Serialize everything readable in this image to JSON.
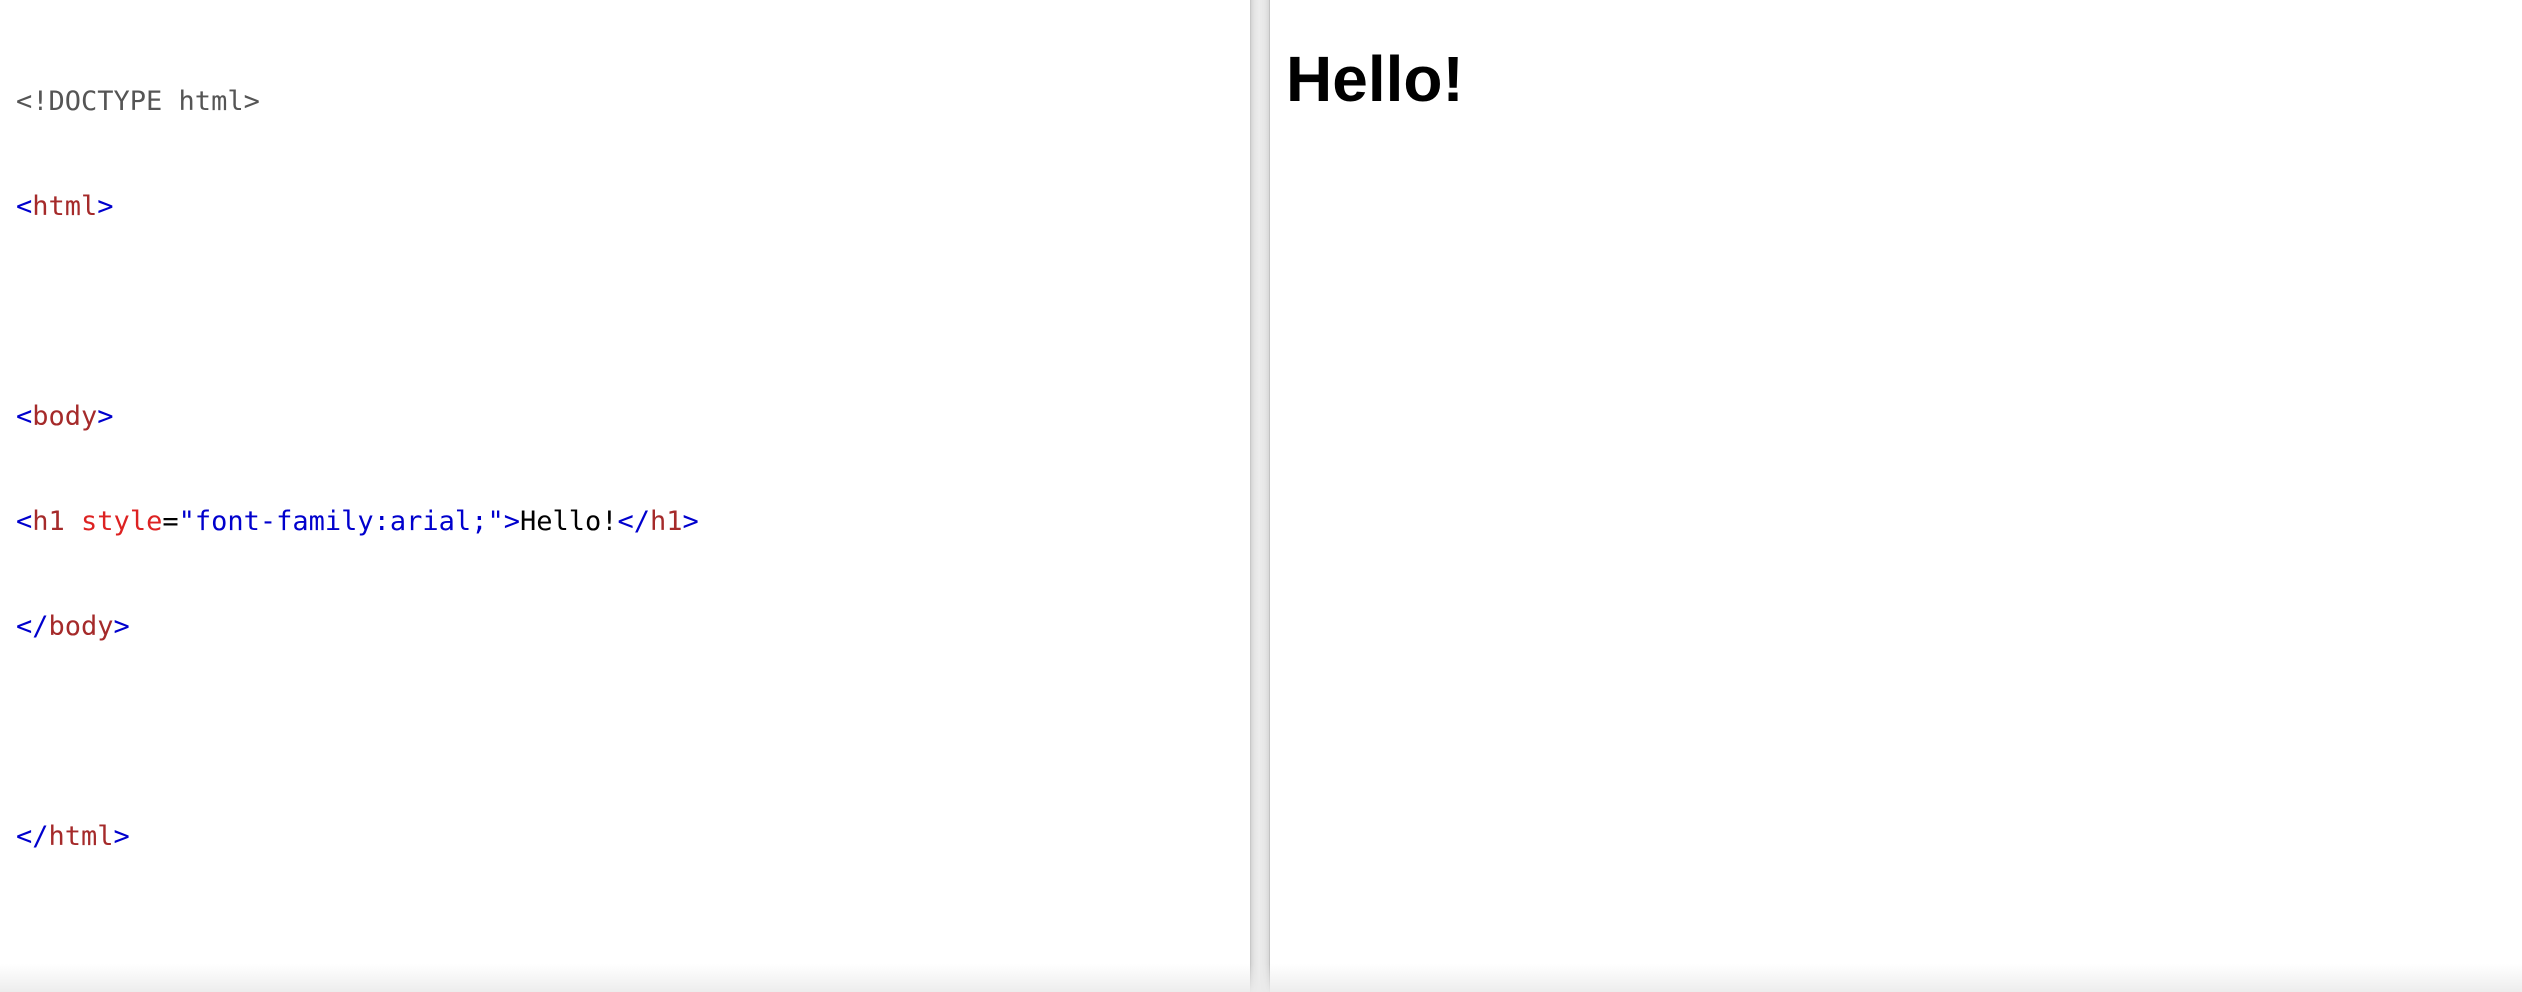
{
  "editor": {
    "lines": [
      {
        "doctype": "<!DOCTYPE html>"
      },
      {
        "open": "<",
        "tag": "html",
        "close": ">"
      },
      {},
      {
        "open": "<",
        "tag": "body",
        "close": ">"
      },
      {
        "open": "<",
        "tag": "h1",
        "space": " ",
        "attr": "style",
        "eq": "=",
        "value": "\"font-family:arial;\"",
        "close": ">",
        "text": "Hello!",
        "end_open": "</",
        "end_tag": "h1",
        "end_close": ">"
      },
      {
        "open": "</",
        "tag": "body",
        "close": ">"
      },
      {},
      {
        "open": "</",
        "tag": "html",
        "close": ">"
      }
    ]
  },
  "preview": {
    "heading": "Hello!"
  },
  "colors": {
    "bracket": "#0000cd",
    "tag": "#a52a2a",
    "attribute": "#dd2222",
    "attribute_value": "#0000cd",
    "doctype": "#555555",
    "text": "#000000"
  }
}
